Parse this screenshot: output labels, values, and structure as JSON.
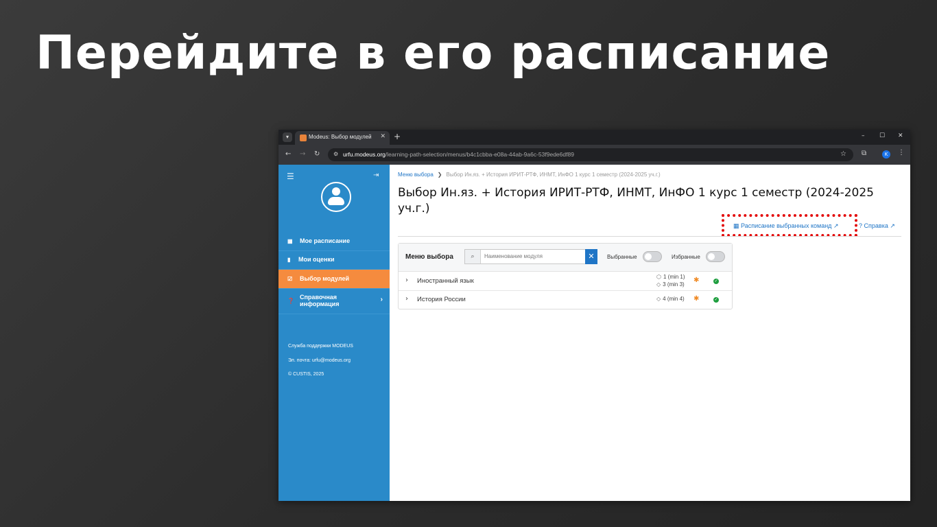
{
  "slide": {
    "title": "Перейдите в его расписание"
  },
  "browser": {
    "tab_title": "Modeus: Выбор модулей",
    "tab_close": "✕",
    "new_tab": "+",
    "url_domain": "urfu.modeus.org",
    "url_path": "/learning-path-selection/menus/b4c1cbba-e08a-44ab-9a6c-53f9ede6df89",
    "profile_initial": "K",
    "window_controls": [
      "–",
      "☐",
      "✕"
    ]
  },
  "sidebar": {
    "items": [
      {
        "label": "Мое расписание",
        "icon": "calendar-icon"
      },
      {
        "label": "Мои оценки",
        "icon": "bookmark-icon"
      },
      {
        "label": "Выбор модулей",
        "icon": "checkbox-icon",
        "active": true
      },
      {
        "label": "Справочная информация",
        "icon": "question-icon"
      }
    ],
    "support_title": "Служба поддержки MODEUS",
    "support_email": "Эл. почта: urfu@modeus.org",
    "copyright": "© CUSTIS, 2025"
  },
  "breadcrumb": {
    "root": "Меню выбора",
    "current": "Выбор Ин.яз. + История ИРИТ-РТФ, ИНМТ, ИнФО 1 курс 1 семестр (2024-2025 уч.г.)"
  },
  "heading": "Выбор Ин.яз. + История ИРИТ-РТФ, ИНМТ, ИнФО 1 курс 1 семестр (2024-2025 уч.г.)",
  "links": {
    "schedule": "Расписание выбранных команд",
    "help": "Справка"
  },
  "menu_card": {
    "title": "Меню выбора",
    "search_placeholder": "Наименование модуля",
    "toggle_selected": "Выбранные",
    "toggle_favorites": "Избранные",
    "rows": [
      {
        "label": "Иностранный язык",
        "stat1": "1 (min 1)",
        "stat2": "3 (min 3)"
      },
      {
        "label": "История России",
        "stat1": "4 (min 4)"
      }
    ]
  },
  "colors": {
    "sidebar": "#2a8ac9",
    "active_item": "#f58b3e",
    "link": "#1f75c6",
    "highlight": "#e30a0a",
    "ok": "#1e9e3e"
  }
}
